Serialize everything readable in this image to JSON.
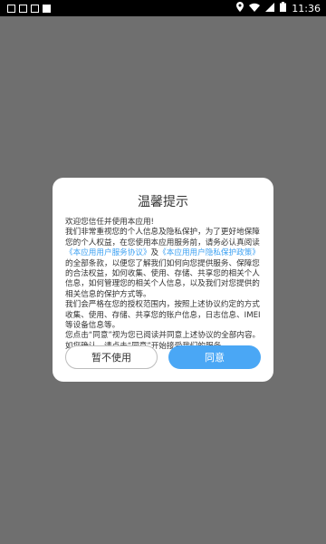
{
  "status_bar": {
    "time": "11:36",
    "icons": [
      "square-outline-icon",
      "square-outline-icon",
      "square-outline-icon",
      "square-solid-icon",
      "location-icon",
      "wifi-icon",
      "signal-icon",
      "battery-icon"
    ]
  },
  "dialog": {
    "title": "温馨提示",
    "body": {
      "p1": "欢迎您信任并使用本应用!",
      "p2_a": "我们非常重视您的个人信息及隐私保护，为了更好地保障您的个人权益，在您使用本应用服务前，请务必认真阅读",
      "link_service": "《本应用用户服务协议》",
      "and": "及",
      "link_privacy": "《本应用用户隐私保护政策》",
      "p2_b": "的全部条款，以便您了解我们如何向您提供服务、保障您的合法权益，如何收集、使用、存储、共享您的相关个人信息，如何管理您的相关个人信息，以及我们对您提供的相关信息的保护方式等。",
      "p3": "我们会严格在您的授权范围内，按照上述协议约定的方式收集、使用、存储、共享您的账户信息，日志信息、IMEI等设备信息等。",
      "p4": "您点击“同意”视为您已阅读并同意上述协议的全部内容。如您确认，请点击“同意”开始接受我们的服务。"
    },
    "decline_label": "暂不使用",
    "accept_label": "同意"
  },
  "colors": {
    "backdrop": "#6f6f6f",
    "link": "#3da1f2",
    "accept": "#4aa7f5"
  }
}
